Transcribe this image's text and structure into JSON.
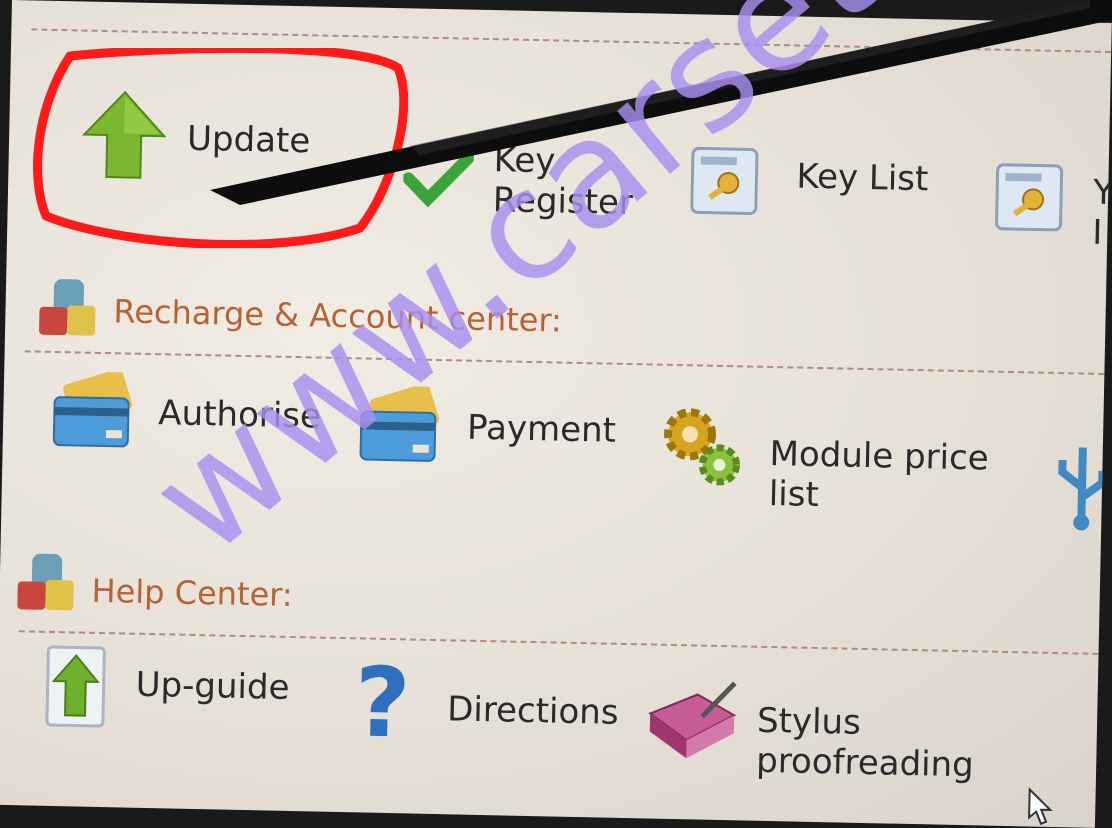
{
  "sections": {
    "recharge_title": "Recharge & Account center:",
    "help_title": "Help Center:"
  },
  "top_row": {
    "update": "Update",
    "key_register": "Key\nRegister",
    "key_list": "Key List",
    "partial": "Y\nI"
  },
  "recharge_row": {
    "authorise": "Authorise",
    "payment": "Payment",
    "module_price_list": "Module price\nlist"
  },
  "help_row": {
    "up_guide": "Up-guide",
    "directions": "Directions",
    "stylus": "Stylus\nproofreading"
  },
  "watermark": "www.carsets.",
  "colors": {
    "section_title": "#b76235",
    "annotation_circle": "#ff1a1a",
    "watermark": "#a98ff0"
  }
}
